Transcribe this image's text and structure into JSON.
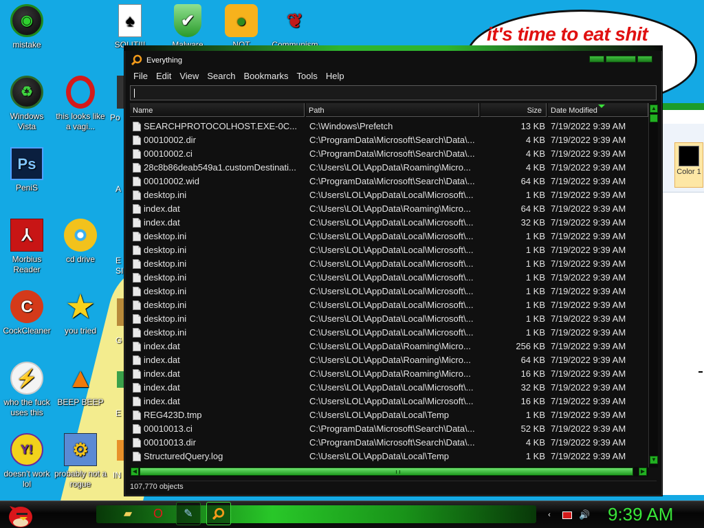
{
  "desktop": {
    "speech_bubble": "it's time to eat shit",
    "paint_color_label": "Color 1",
    "icons": [
      {
        "label": "mistake",
        "icon": "green-orb-icon"
      },
      {
        "label": "Windows Vista",
        "icon": "recycle-bin-icon"
      },
      {
        "label": "PeniS",
        "icon": "photoshop-icon"
      },
      {
        "label": "Morbius Reader",
        "icon": "pdf-reader-icon"
      },
      {
        "label": "CockCleaner",
        "icon": "ccleaner-icon"
      },
      {
        "label": "who the fuck uses this",
        "icon": "lightning-icon"
      },
      {
        "label": "doesn't work lol",
        "icon": "yahoo-messenger-icon"
      },
      {
        "label": "SOLIT!!!",
        "icon": "solitaire-icon"
      },
      {
        "label": "Malware",
        "icon": "shield-check-icon"
      },
      {
        "label": "NOT",
        "icon": "angry-birds-pig-icon"
      },
      {
        "label": "Communism",
        "icon": "bird-emblem-icon"
      },
      {
        "label": "this looks like a vagi...",
        "icon": "opera-icon"
      },
      {
        "label": "cd drive",
        "icon": "cd-icon"
      },
      {
        "label": "you tried",
        "icon": "star-icon"
      },
      {
        "label": "BEEP BEEP",
        "icon": "vlc-cone-icon"
      },
      {
        "label": "probably not a rogue",
        "icon": "gears-icon"
      },
      {
        "label": "Po",
        "icon": "partial-icon"
      },
      {
        "label": "A",
        "icon": "partial-icon"
      },
      {
        "label": "E SIM",
        "icon": "partial-icon"
      },
      {
        "label": "G",
        "icon": "partial-icon"
      },
      {
        "label": "E",
        "icon": "partial-icon"
      },
      {
        "label": "IN",
        "icon": "partial-icon"
      }
    ]
  },
  "window": {
    "title": "Everything",
    "menu": [
      "File",
      "Edit",
      "View",
      "Search",
      "Bookmarks",
      "Tools",
      "Help"
    ],
    "search_value": "",
    "columns": {
      "name": "Name",
      "path": "Path",
      "size": "Size",
      "date": "Date Modified"
    },
    "rows": [
      {
        "name": "SEARCHPROTOCOLHOST.EXE-0C...",
        "path": "C:\\Windows\\Prefetch",
        "size": "13 KB",
        "date": "7/19/2022 9:39 AM"
      },
      {
        "name": "00010002.dir",
        "path": "C:\\ProgramData\\Microsoft\\Search\\Data\\...",
        "size": "4 KB",
        "date": "7/19/2022 9:39 AM"
      },
      {
        "name": "00010002.ci",
        "path": "C:\\ProgramData\\Microsoft\\Search\\Data\\...",
        "size": "4 KB",
        "date": "7/19/2022 9:39 AM"
      },
      {
        "name": "28c8b86deab549a1.customDestinati...",
        "path": "C:\\Users\\LOL\\AppData\\Roaming\\Micro...",
        "size": "4 KB",
        "date": "7/19/2022 9:39 AM"
      },
      {
        "name": "00010002.wid",
        "path": "C:\\ProgramData\\Microsoft\\Search\\Data\\...",
        "size": "64 KB",
        "date": "7/19/2022 9:39 AM"
      },
      {
        "name": "desktop.ini",
        "path": "C:\\Users\\LOL\\AppData\\Local\\Microsoft\\...",
        "size": "1 KB",
        "date": "7/19/2022 9:39 AM"
      },
      {
        "name": "index.dat",
        "path": "C:\\Users\\LOL\\AppData\\Roaming\\Micro...",
        "size": "64 KB",
        "date": "7/19/2022 9:39 AM"
      },
      {
        "name": "index.dat",
        "path": "C:\\Users\\LOL\\AppData\\Local\\Microsoft\\...",
        "size": "32 KB",
        "date": "7/19/2022 9:39 AM"
      },
      {
        "name": "desktop.ini",
        "path": "C:\\Users\\LOL\\AppData\\Local\\Microsoft\\...",
        "size": "1 KB",
        "date": "7/19/2022 9:39 AM"
      },
      {
        "name": "desktop.ini",
        "path": "C:\\Users\\LOL\\AppData\\Local\\Microsoft\\...",
        "size": "1 KB",
        "date": "7/19/2022 9:39 AM"
      },
      {
        "name": "desktop.ini",
        "path": "C:\\Users\\LOL\\AppData\\Local\\Microsoft\\...",
        "size": "1 KB",
        "date": "7/19/2022 9:39 AM"
      },
      {
        "name": "desktop.ini",
        "path": "C:\\Users\\LOL\\AppData\\Local\\Microsoft\\...",
        "size": "1 KB",
        "date": "7/19/2022 9:39 AM"
      },
      {
        "name": "desktop.ini",
        "path": "C:\\Users\\LOL\\AppData\\Local\\Microsoft\\...",
        "size": "1 KB",
        "date": "7/19/2022 9:39 AM"
      },
      {
        "name": "desktop.ini",
        "path": "C:\\Users\\LOL\\AppData\\Local\\Microsoft\\...",
        "size": "1 KB",
        "date": "7/19/2022 9:39 AM"
      },
      {
        "name": "desktop.ini",
        "path": "C:\\Users\\LOL\\AppData\\Local\\Microsoft\\...",
        "size": "1 KB",
        "date": "7/19/2022 9:39 AM"
      },
      {
        "name": "desktop.ini",
        "path": "C:\\Users\\LOL\\AppData\\Local\\Microsoft\\...",
        "size": "1 KB",
        "date": "7/19/2022 9:39 AM"
      },
      {
        "name": "index.dat",
        "path": "C:\\Users\\LOL\\AppData\\Roaming\\Micro...",
        "size": "256 KB",
        "date": "7/19/2022 9:39 AM"
      },
      {
        "name": "index.dat",
        "path": "C:\\Users\\LOL\\AppData\\Roaming\\Micro...",
        "size": "64 KB",
        "date": "7/19/2022 9:39 AM"
      },
      {
        "name": "index.dat",
        "path": "C:\\Users\\LOL\\AppData\\Roaming\\Micro...",
        "size": "16 KB",
        "date": "7/19/2022 9:39 AM"
      },
      {
        "name": "index.dat",
        "path": "C:\\Users\\LOL\\AppData\\Local\\Microsoft\\...",
        "size": "32 KB",
        "date": "7/19/2022 9:39 AM"
      },
      {
        "name": "index.dat",
        "path": "C:\\Users\\LOL\\AppData\\Local\\Microsoft\\...",
        "size": "16 KB",
        "date": "7/19/2022 9:39 AM"
      },
      {
        "name": "REG423D.tmp",
        "path": "C:\\Users\\LOL\\AppData\\Local\\Temp",
        "size": "1 KB",
        "date": "7/19/2022 9:39 AM"
      },
      {
        "name": "00010013.ci",
        "path": "C:\\ProgramData\\Microsoft\\Search\\Data\\...",
        "size": "52 KB",
        "date": "7/19/2022 9:39 AM"
      },
      {
        "name": "00010013.dir",
        "path": "C:\\ProgramData\\Microsoft\\Search\\Data\\...",
        "size": "4 KB",
        "date": "7/19/2022 9:39 AM"
      },
      {
        "name": "StructuredQuery.log",
        "path": "C:\\Users\\LOL\\AppData\\Local\\Temp",
        "size": "1 KB",
        "date": "7/19/2022 9:39 AM"
      }
    ],
    "status": "107,770 objects"
  },
  "taskbar": {
    "clock": "9:39 AM",
    "buttons": [
      "explorer-folder-icon",
      "opera-icon",
      "paint-icon",
      "everything-search-icon"
    ],
    "tray": [
      "back-arrow-icon",
      "network-icon",
      "speaker-icon"
    ]
  },
  "colors": {
    "desktop_bg": "#14a9e4",
    "accent_green": "#2fb52f",
    "clock_green": "#39e639",
    "window_bg": "#101010",
    "bubble_text": "#e01010"
  }
}
